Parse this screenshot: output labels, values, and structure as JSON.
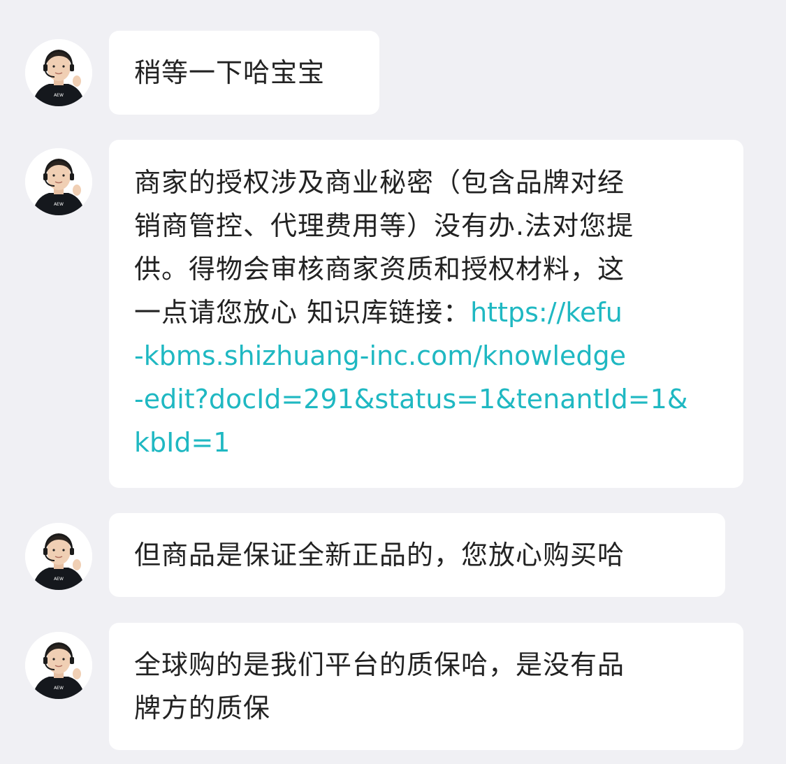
{
  "messages": [
    {
      "lines": [
        "稍等一下哈宝宝"
      ]
    },
    {
      "lines": [
        "商家的授权涉及商业秘密（包含品牌对经",
        "销商管控、代理费用等）没有办.法对您提",
        "供。得物会审核商家资质和授权材料，这"
      ],
      "line4_text": "一点请您放心 知识库链接：",
      "line4_link": "https://kefu",
      "link_lines": [
        "-kbms.shizhuang-inc.com/knowledge",
        "-edit?docId=291&status=1&tenantId=1&",
        "kbId=1"
      ]
    },
    {
      "lines": [
        "但商品是保证全新正品的，您放心购买哈"
      ]
    },
    {
      "lines": [
        "全球购的是我们平台的质保哈，是没有品",
        "牌方的质保"
      ]
    }
  ],
  "avatar": {
    "icon": "agent-avatar-icon",
    "shirt_text": "AEW"
  },
  "colors": {
    "background": "#f0f0f4",
    "bubble": "#ffffff",
    "text": "#222222",
    "link": "#1fb8c2"
  }
}
